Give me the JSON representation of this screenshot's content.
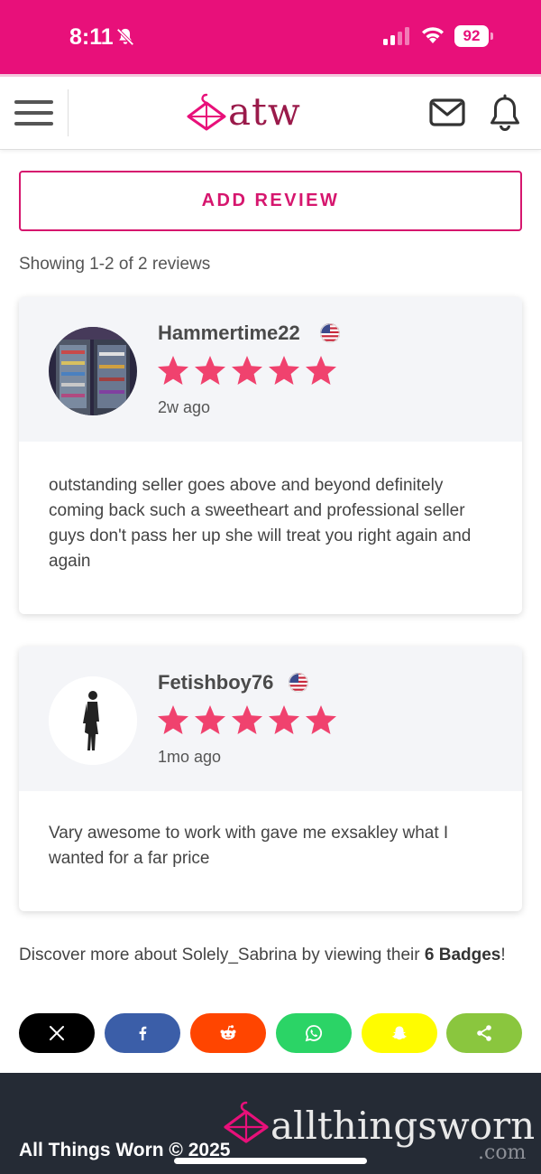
{
  "status_bar": {
    "time": "8:11",
    "battery": "92"
  },
  "header": {
    "logo": "atw"
  },
  "main": {
    "add_review_label": "ADD REVIEW",
    "showing_text": "Showing 1-2 of 2 reviews"
  },
  "reviews": [
    {
      "name": "Hammertime22",
      "rating": 5,
      "time_ago": "2w ago",
      "text": "outstanding seller goes above and beyond definitely coming back such a sweetheart and professional seller guys don't pass her up she will treat you right again and again"
    },
    {
      "name": "Fetishboy76",
      "rating": 5,
      "time_ago": "1mo ago",
      "text": "Vary awesome to work with gave me exsakley what I wanted for a far price"
    }
  ],
  "discover": {
    "prefix": "Discover more about Solely_Sabrina by viewing their ",
    "badges": "6 Badges",
    "suffix": "!"
  },
  "share_buttons": [
    {
      "name": "x",
      "color": "#000000"
    },
    {
      "name": "facebook",
      "color": "#3b5ea8"
    },
    {
      "name": "reddit",
      "color": "#ff4500"
    },
    {
      "name": "whatsapp",
      "color": "#2bd466"
    },
    {
      "name": "snapchat",
      "color": "#fffc00"
    },
    {
      "name": "share",
      "color": "#8ac63e"
    }
  ],
  "footer": {
    "copyright": "All Things Worn © 2025",
    "logo_text": "allthingsworn",
    "logo_suffix": ".com"
  },
  "colors": {
    "brand_pink": "#e8107a",
    "star": "#f0426e",
    "footer_bg": "#252b35"
  }
}
